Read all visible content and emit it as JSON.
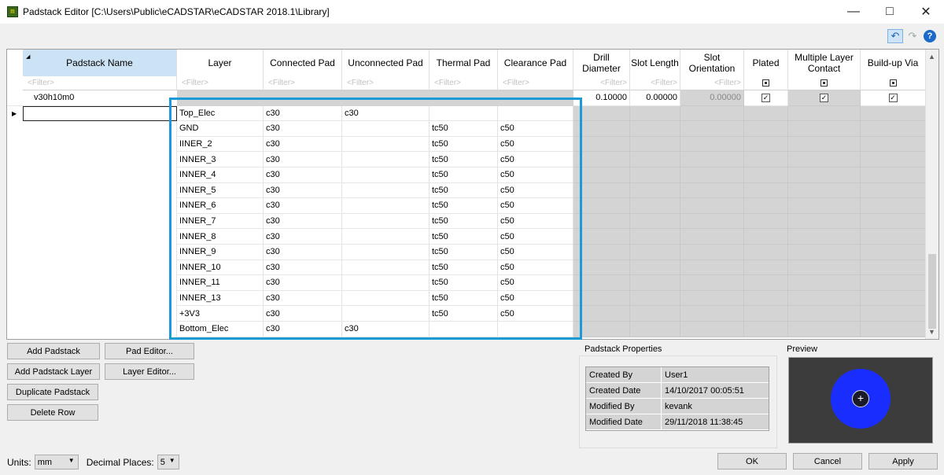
{
  "window": {
    "title": "Padstack Editor [C:\\Users\\Public\\eCADSTAR\\eCADSTAR 2018.1\\Library]",
    "app_icon": "ecad-icon",
    "controls": [
      "minimize-icon",
      "maximize-icon",
      "close-icon"
    ]
  },
  "toolbar": {
    "undo_icon": "undo-icon",
    "redo_icon": "redo-icon",
    "help_label": "?"
  },
  "grid": {
    "columns": [
      {
        "key": "name",
        "label": "Padstack Name"
      },
      {
        "key": "layer",
        "label": "Layer"
      },
      {
        "key": "connected",
        "label": "Connected Pad"
      },
      {
        "key": "unconnected",
        "label": "Unconnected Pad"
      },
      {
        "key": "thermal",
        "label": "Thermal Pad"
      },
      {
        "key": "clearance",
        "label": "Clearance Pad"
      },
      {
        "key": "drill",
        "label": "Drill Diameter"
      },
      {
        "key": "slotlen",
        "label": "Slot Length"
      },
      {
        "key": "slotori",
        "label": "Slot Orientation"
      },
      {
        "key": "plated",
        "label": "Plated"
      },
      {
        "key": "multi",
        "label": "Multiple Layer Contact"
      },
      {
        "key": "buildup",
        "label": "Build-up Via"
      }
    ],
    "filter_placeholder": "<Filter>",
    "padstack": {
      "name": "v30h10m0",
      "drill": "0.10000",
      "slot_length": "0.00000",
      "slot_orientation": "0.00000",
      "plated": true,
      "multiple_layer_contact": true,
      "build_up_via": true
    },
    "layers": [
      {
        "layer": "Top_Elec",
        "connected": "c30",
        "unconnected": "c30",
        "thermal": "",
        "clearance": ""
      },
      {
        "layer": "GND",
        "connected": "c30",
        "unconnected": "",
        "thermal": "tc50",
        "clearance": "c50"
      },
      {
        "layer": "IINER_2",
        "connected": "c30",
        "unconnected": "",
        "thermal": "tc50",
        "clearance": "c50"
      },
      {
        "layer": "INNER_3",
        "connected": "c30",
        "unconnected": "",
        "thermal": "tc50",
        "clearance": "c50"
      },
      {
        "layer": "INNER_4",
        "connected": "c30",
        "unconnected": "",
        "thermal": "tc50",
        "clearance": "c50"
      },
      {
        "layer": "INNER_5",
        "connected": "c30",
        "unconnected": "",
        "thermal": "tc50",
        "clearance": "c50"
      },
      {
        "layer": "INNER_6",
        "connected": "c30",
        "unconnected": "",
        "thermal": "tc50",
        "clearance": "c50"
      },
      {
        "layer": "INNER_7",
        "connected": "c30",
        "unconnected": "",
        "thermal": "tc50",
        "clearance": "c50"
      },
      {
        "layer": "INNER_8",
        "connected": "c30",
        "unconnected": "",
        "thermal": "tc50",
        "clearance": "c50"
      },
      {
        "layer": "INNER_9",
        "connected": "c30",
        "unconnected": "",
        "thermal": "tc50",
        "clearance": "c50"
      },
      {
        "layer": "INNER_10",
        "connected": "c30",
        "unconnected": "",
        "thermal": "tc50",
        "clearance": "c50"
      },
      {
        "layer": "INNER_11",
        "connected": "c30",
        "unconnected": "",
        "thermal": "tc50",
        "clearance": "c50"
      },
      {
        "layer": "INNER_13",
        "connected": "c30",
        "unconnected": "",
        "thermal": "tc50",
        "clearance": "c50"
      },
      {
        "layer": "+3V3",
        "connected": "c30",
        "unconnected": "",
        "thermal": "tc50",
        "clearance": "c50"
      },
      {
        "layer": "Bottom_Elec",
        "connected": "c30",
        "unconnected": "c30",
        "thermal": "",
        "clearance": ""
      }
    ]
  },
  "buttons": {
    "add_padstack": "Add Padstack",
    "pad_editor": "Pad Editor...",
    "add_padstack_layer": "Add Padstack Layer",
    "layer_editor": "Layer Editor...",
    "duplicate_padstack": "Duplicate Padstack",
    "delete_row": "Delete Row",
    "ok": "OK",
    "cancel": "Cancel",
    "apply": "Apply"
  },
  "properties": {
    "title": "Padstack Properties",
    "rows": [
      {
        "key": "Created By",
        "value": "User1"
      },
      {
        "key": "Created Date",
        "value": "14/10/2017 00:05:51"
      },
      {
        "key": "Modified By",
        "value": "kevank"
      },
      {
        "key": "Modified Date",
        "value": "29/11/2018 11:38:45"
      }
    ]
  },
  "preview": {
    "title": "Preview",
    "pad_color": "#1a2dff",
    "drill_mark": "+"
  },
  "footer": {
    "units_label": "Units:",
    "units_value": "mm",
    "decimal_label": "Decimal Places:",
    "decimal_value": "5"
  },
  "colors": {
    "selection_border": "#1a9ad6",
    "name_header_bg": "#cce3f5",
    "disabled_cell": "#d4d4d4"
  }
}
